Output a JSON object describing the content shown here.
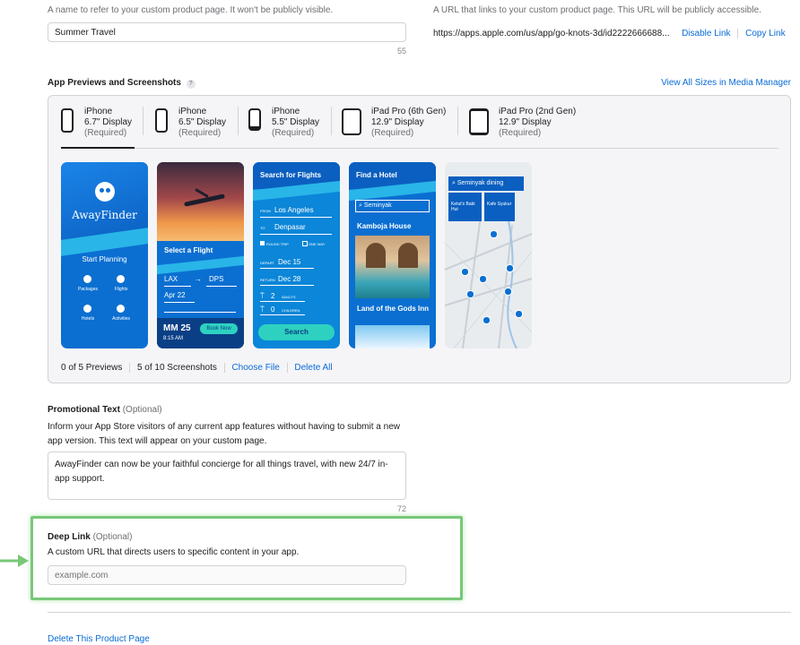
{
  "name_section": {
    "description": "A name to refer to your custom product page. It won't be publicly visible.",
    "value": "Summer Travel",
    "counter": "55"
  },
  "url_section": {
    "description": "A URL that links to your custom product page. This URL will be publicly accessible.",
    "url": "https://apps.apple.com/us/app/go-knots-3d/id2222666688...",
    "disable_link": "Disable Link",
    "copy_link": "Copy Link"
  },
  "media": {
    "title": "App Previews and Screenshots",
    "help": "?",
    "view_all": "View All Sizes in Media Manager",
    "devices": [
      {
        "name": "iPhone",
        "size": "6.7\" Display",
        "status": "(Required)"
      },
      {
        "name": "iPhone",
        "size": "6.5\" Display",
        "status": "(Required)"
      },
      {
        "name": "iPhone",
        "size": "5.5\" Display",
        "status": "(Required)"
      },
      {
        "name": "iPad Pro (6th Gen)",
        "size": "12.9\" Display",
        "status": "(Required)"
      },
      {
        "name": "iPad Pro (2nd Gen)",
        "size": "12.9\" Display",
        "status": "(Required)"
      }
    ],
    "shots": {
      "s1": {
        "brand": "AwayFinder",
        "start": "Start Planning",
        "packages": "Packages",
        "flights": "Flights",
        "hotels": "Hotels",
        "activities": "Activities"
      },
      "s2": {
        "title": "Select a Flight",
        "from": "LAX",
        "to": "DPS",
        "date": "Apr 22",
        "price": "MM 25",
        "time": "8:15 AM",
        "book": "Book Now"
      },
      "s3": {
        "title": "Search for Flights",
        "from_label": "FROM",
        "from": "Los Angeles",
        "to_label": "TO",
        "to": "Denpasar",
        "round": "ROUND TRIP",
        "oneway": "ONE WAY",
        "depart_label": "DEPART",
        "depart": "Dec 15",
        "return_label": "RETURN",
        "return": "Dec 28",
        "adults": "2",
        "adults_label": "ADULTS",
        "children": "0",
        "children_label": "CHILDREN",
        "search": "Search"
      },
      "s4": {
        "title": "Find a Hotel",
        "search": "Seminyak",
        "hotel1": "Kamboja House",
        "hotel2": "Land of the Gods Inn"
      },
      "s5": {
        "search": "Seminyak dining",
        "place1": "Ketut's Babi Hut",
        "place2": "Kafe Syukur"
      }
    },
    "footer": {
      "previews": "0 of 5 Previews",
      "screenshots": "5 of 10 Screenshots",
      "choose": "Choose File",
      "delete_all": "Delete All"
    }
  },
  "promo": {
    "label": "Promotional Text",
    "optional": "(Optional)",
    "description": "Inform your App Store visitors of any current app features without having to submit a new app version. This text will appear on your custom page.",
    "value": "AwayFinder can now be your faithful concierge for all things travel, with new 24/7 in-app support.",
    "counter": "72"
  },
  "deep_link": {
    "label": "Deep Link",
    "optional": "(Optional)",
    "description": "A custom URL that directs users to specific content in your app.",
    "placeholder": "example.com"
  },
  "delete_page": "Delete This Product Page",
  "colors": {
    "accent": "#0a6bd6",
    "highlight": "#78c878",
    "app_blue": "#0b6fd1"
  }
}
